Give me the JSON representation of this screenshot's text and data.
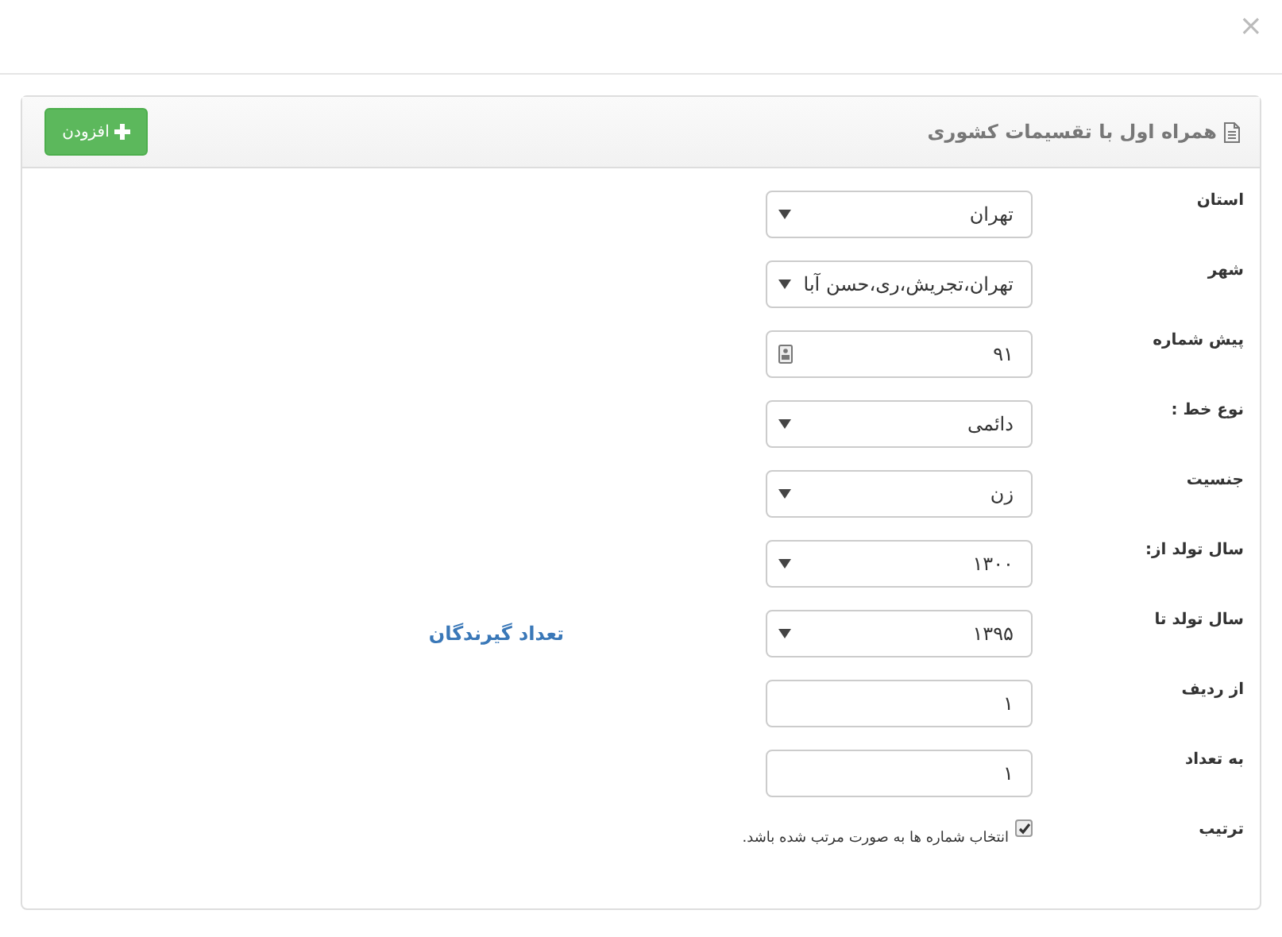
{
  "dialog": {
    "close": "×"
  },
  "panel": {
    "title": "همراه اول با تقسیمات کشوری",
    "add_button": "افزودن"
  },
  "fields": [
    {
      "label": "استان",
      "kind": "select",
      "value": "تهران"
    },
    {
      "label": "شهر",
      "kind": "select",
      "value": "تهران،تجریش،ری،حسن آبا"
    },
    {
      "label": "پیش شماره",
      "kind": "contact-input",
      "value": "۹۱"
    },
    {
      "label": "نوع خط :",
      "kind": "select",
      "value": "دائمی"
    },
    {
      "label": "جنسیت",
      "kind": "select",
      "value": "زن"
    },
    {
      "label": "سال تولد از:",
      "kind": "select",
      "value": "۱۳۰۰"
    },
    {
      "label": "سال تولد تا",
      "kind": "select",
      "value": "۱۳۹۵",
      "side_text": "تعداد گیرندگان"
    },
    {
      "label": "از ردیف",
      "kind": "input",
      "value": "۱"
    },
    {
      "label": "به تعداد",
      "kind": "input",
      "value": "۱"
    },
    {
      "label": "ترتیب",
      "kind": "checkbox",
      "checked": true,
      "text": "انتخاب شماره ها به صورت مرتب شده باشد."
    }
  ]
}
